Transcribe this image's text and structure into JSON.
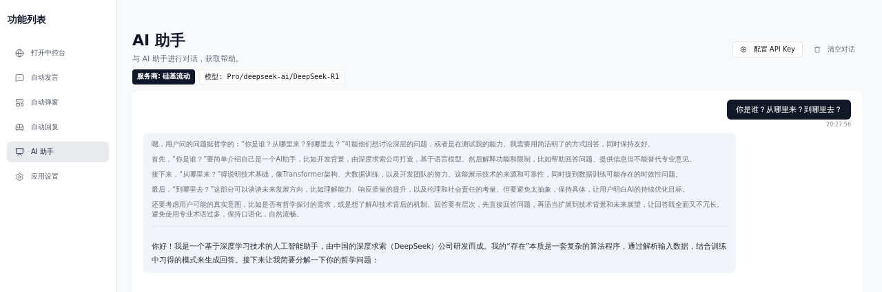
{
  "sidebar": {
    "title": "功能列表",
    "items": [
      {
        "label": "打开中控台",
        "selected": false
      },
      {
        "label": "自动发言",
        "selected": false
      },
      {
        "label": "自动弹窗",
        "selected": false
      },
      {
        "label": "自动回复",
        "selected": false
      },
      {
        "label": "AI 助手",
        "selected": true
      },
      {
        "label": "应用设置",
        "selected": false
      }
    ]
  },
  "header": {
    "title": "AI 助手",
    "subtitle": "与 AI 助手进行对话，获取帮助。",
    "badges": [
      {
        "kind": "dark",
        "text": "服务商: 硅基流动"
      },
      {
        "kind": "light",
        "text": "模型: Pro/deepseek-ai/DeepSeek-R1"
      }
    ],
    "actions": [
      {
        "kind": "outline",
        "label": "配置 API Key"
      },
      {
        "kind": "ghost",
        "label": "清空对话"
      }
    ]
  },
  "messages": [
    {
      "kind": "user",
      "text": "你是谁？从哪里来？到哪里去？",
      "time": "20:27:56"
    },
    {
      "kind": "assistant",
      "thinking": [
        "嗯，用户问的问题挺哲学的：“你是谁？从哪里来？到哪里去？”可能他们想讨论深层的问题，或者是在测试我的能力。我需要用简洁明了的方式回答，同时保持友好。",
        "首先，“你是谁？”要简单介绍自己是一个AI助手，比如开发背景，由深度求索公司打造，基于语言模型。然后解释功能和限制，比如帮助回答问题、提供信息但不能替代专业意见。",
        "接下来，“从哪里来？”得说明技术基础，像Transformer架构、大数据训练，以及开发团队的努力。这能展示技术的来源和可靠性，同时提到数据训练可能存在的时效性问题。",
        "最后，“到哪里去？”这部分可以谈谈未来发展方向，比如理解能力、响应质量的提升，以及伦理和社会责任的考量。但要避免太抽象，保持具体，让用户明白AI的持续优化目标。",
        "还要考虑用户可能的真实意图，比如是否有哲学探讨的需求，或是想了解AI技术背后的机制。回答要有层次，先直接回答问题，再适当扩展到技术背景和未来展望，让回答既全面又不冗长。避免使用专业术语过多，保持口语化，自然流畅。"
      ],
      "text": "你好！我是一个基于深度学习技术的人工智能助手，由中国的深度求索（DeepSeek）公司研发而成。我的“存在”本质是一套复杂的算法程序，通过解析输入数据，结合训练中习得的模式来生成回答。接下来让我简要分解一下你的哲学问题："
    }
  ]
}
